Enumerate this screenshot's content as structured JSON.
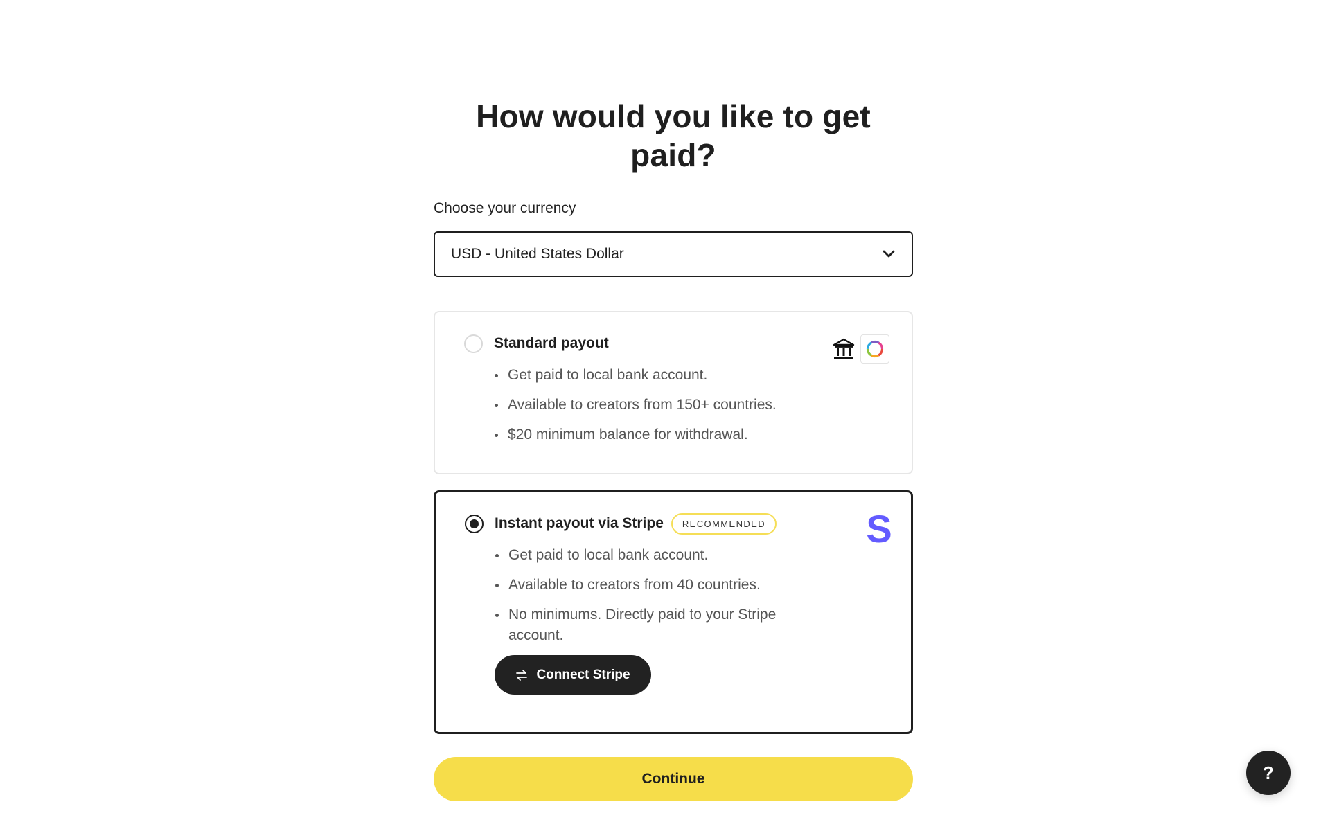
{
  "page": {
    "title": "How would you like to get paid?"
  },
  "currency": {
    "label": "Choose your currency",
    "selected": "USD - United States Dollar"
  },
  "options": [
    {
      "title": "Standard payout",
      "selected": false,
      "bullets": [
        "Get paid to local bank account.",
        "Available to creators from 150+ countries.",
        "$20 minimum balance for withdrawal."
      ],
      "icons": [
        "bank-icon",
        "payoneer-ring-icon"
      ]
    },
    {
      "title": "Instant payout via Stripe",
      "badge": "RECOMMENDED",
      "selected": true,
      "bullets": [
        "Get paid to local bank account.",
        "Available to creators from 40 countries.",
        "No minimums. Directly paid to your Stripe account."
      ],
      "icons": [
        "stripe-logo"
      ],
      "connect_label": "Connect Stripe"
    }
  ],
  "actions": {
    "continue_label": "Continue",
    "help_label": "?"
  },
  "colors": {
    "accent_yellow": "#f6dd4a",
    "dark": "#222222",
    "stripe_purple": "#635bff",
    "badge_border": "#f5de57"
  }
}
